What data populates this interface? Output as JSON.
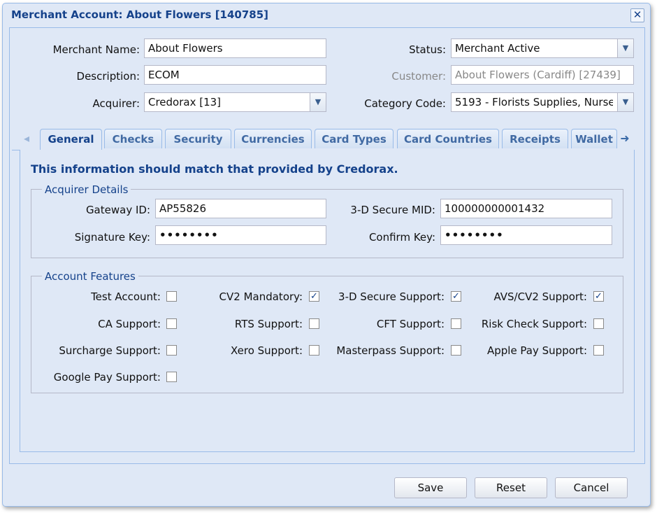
{
  "window": {
    "title": "Merchant Account: About Flowers [140785]",
    "close_glyph": "✕"
  },
  "form": {
    "merchant_name": {
      "label": "Merchant Name:",
      "value": "About Flowers"
    },
    "description": {
      "label": "Description:",
      "value": "ECOM"
    },
    "acquirer": {
      "label": "Acquirer:",
      "value": "Credorax [13]"
    },
    "status": {
      "label": "Status:",
      "value": "Merchant Active"
    },
    "customer": {
      "label": "Customer:",
      "value": "About Flowers (Cardiff) [27439]"
    },
    "category_code": {
      "label": "Category Code:",
      "value": "5193 - Florists Supplies, Nurse"
    }
  },
  "tabs": [
    "General",
    "Checks",
    "Security",
    "Currencies",
    "Card Types",
    "Card Countries",
    "Receipts",
    "Wallet"
  ],
  "tab_scroll": {
    "left": "◂",
    "right": "➜"
  },
  "general": {
    "info": "This information should match that provided by Credorax.",
    "acquirer_details": {
      "legend": "Acquirer Details",
      "gateway_id": {
        "label": "Gateway ID:",
        "value": "AP55826"
      },
      "secure_mid": {
        "label": "3-D Secure MID:",
        "value": "100000000001432"
      },
      "signature_key": {
        "label": "Signature Key:",
        "value": "••••••••"
      },
      "confirm_key": {
        "label": "Confirm Key:",
        "value": "••••••••"
      }
    },
    "account_features": {
      "legend": "Account Features",
      "items": [
        {
          "label": "Test Account:",
          "checked": false
        },
        {
          "label": "CV2 Mandatory:",
          "checked": true
        },
        {
          "label": "3-D Secure Support:",
          "checked": true
        },
        {
          "label": "AVS/CV2 Support:",
          "checked": true
        },
        {
          "label": "CA Support:",
          "checked": false
        },
        {
          "label": "RTS Support:",
          "checked": false
        },
        {
          "label": "CFT Support:",
          "checked": false
        },
        {
          "label": "Risk Check Support:",
          "checked": false
        },
        {
          "label": "Surcharge Support:",
          "checked": false
        },
        {
          "label": "Xero Support:",
          "checked": false
        },
        {
          "label": "Masterpass Support:",
          "checked": false
        },
        {
          "label": "Apple Pay Support:",
          "checked": false
        },
        {
          "label": "Google Pay Support:",
          "checked": false
        }
      ]
    }
  },
  "buttons": {
    "save": "Save",
    "reset": "Reset",
    "cancel": "Cancel"
  },
  "icons": {
    "dropdown": "chevron-down-icon",
    "checkmark": "check-icon"
  }
}
